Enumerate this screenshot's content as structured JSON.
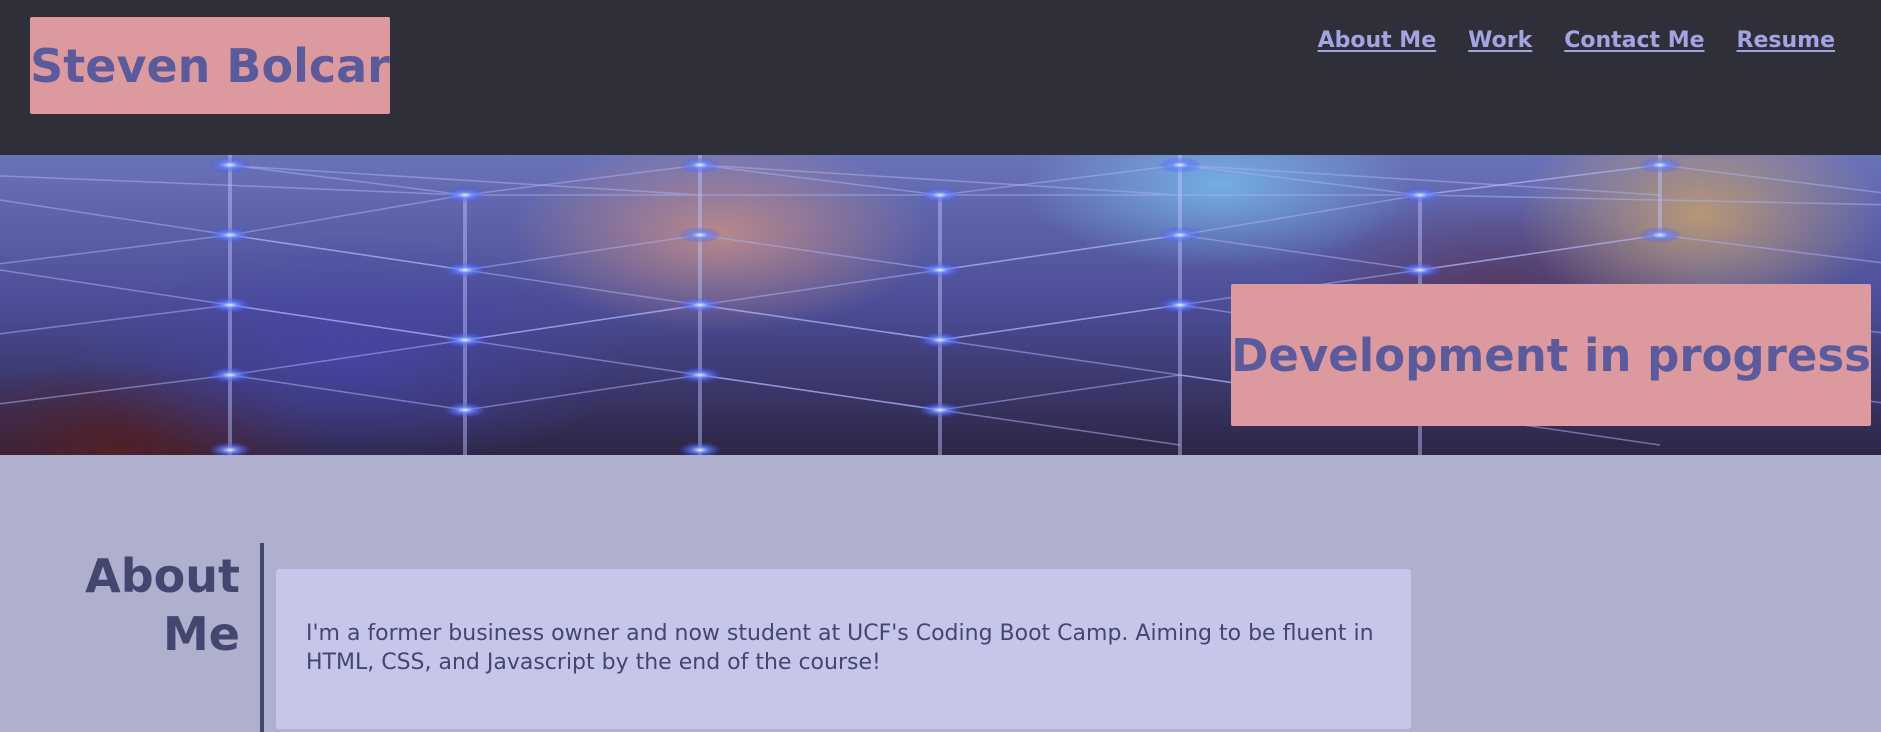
{
  "header": {
    "brand_name": "Steven Bolcar",
    "nav": [
      {
        "label": "About Me"
      },
      {
        "label": "Work"
      },
      {
        "label": "Contact Me"
      },
      {
        "label": "Resume"
      }
    ]
  },
  "hero": {
    "badge_text": "Development in progress"
  },
  "about": {
    "title": "About Me",
    "body": "I'm a former business owner and now student at UCF's Coding Boot Camp. Aiming to be fluent in HTML, CSS, and Javascript by the end of the course!"
  },
  "colors": {
    "header_bg": "#2f2f39",
    "accent_pink": "#dc9a9f",
    "brand_text": "#5a5a9c",
    "nav_link": "#a4a4e4",
    "page_bg": "#aeb0cd",
    "card_bg": "#c6c6ea",
    "heading_text": "#45466f"
  }
}
